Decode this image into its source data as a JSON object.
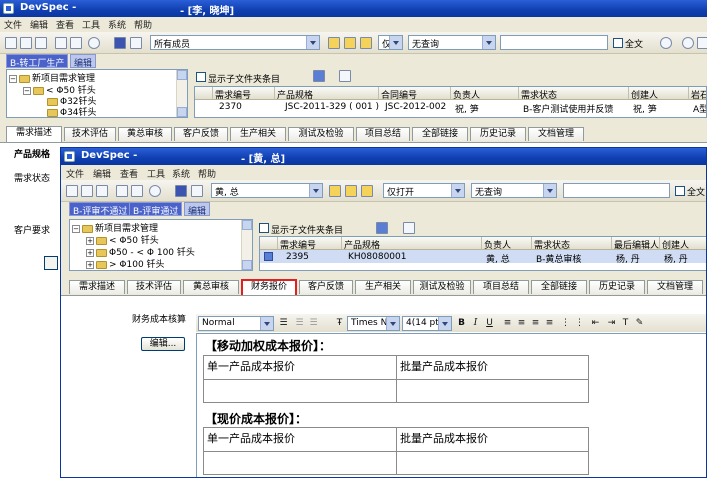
{
  "back_window": {
    "title": "DevSpec -",
    "user": "- [李, 晓坤]",
    "menu": [
      "文件",
      "编辑",
      "查看",
      "工具",
      "系统",
      "帮助"
    ],
    "member_filter": "所有成员",
    "open_filter": "仅打开",
    "query_filter": "无查询",
    "search_value": "",
    "fulltext_label": "全文",
    "buttons": {
      "transfer": "B-转工厂生产",
      "edit": "编辑"
    },
    "tree": [
      {
        "label": "新项目需求管理",
        "level": 0
      },
      {
        "label": "< Φ50 钎头",
        "level": 1
      },
      {
        "label": "Φ32钎头",
        "level": 2
      },
      {
        "label": "Φ34钎头",
        "level": 2
      }
    ],
    "show_subfolder": "显示子文件夹条目",
    "grid_headers": [
      "需求编号",
      "产品规格",
      "合同编号",
      "负责人",
      "需求状态",
      "创建人",
      "岩石"
    ],
    "grid_row": {
      "id": "2370",
      "spec": "JSC-2011-329 ( 001 )",
      "contract": "JSC-2012-002",
      "owner": "祝, 笋",
      "status": "B-客户测试使用并反馈",
      "creator": "祝, 笋",
      "rock": "A型"
    },
    "tabs": [
      "需求描述",
      "技术评估",
      "黄总审核",
      "客户反馈",
      "生产相关",
      "测试及检验",
      "项目总结",
      "全部链接",
      "历史记录",
      "文档管理"
    ],
    "side_labels": [
      "产品规格",
      "需求状态",
      "客户要求"
    ]
  },
  "front_window": {
    "title": "DevSpec -",
    "user": "- [黄, 总]",
    "menu": [
      "文件",
      "编辑",
      "查看",
      "工具",
      "系统",
      "帮助"
    ],
    "member_filter": "黄, 总",
    "open_filter": "仅打开",
    "query_filter": "无查询",
    "search_value": "",
    "fulltext_label": "全文",
    "buttons": {
      "reject": "B-评审不通过",
      "pass": "B-评审通过",
      "edit": "编辑"
    },
    "tree": [
      {
        "label": "新项目需求管理",
        "level": 0
      },
      {
        "label": "< Φ50 钎头",
        "level": 1
      },
      {
        "label": "Φ50 - < Φ 100 钎头",
        "level": 1
      },
      {
        "label": "> Φ100 钎头",
        "level": 1
      }
    ],
    "show_subfolder": "显示子文件夹条目",
    "grid_headers": [
      "需求编号",
      "产品规格",
      "负责人",
      "需求状态",
      "最后编辑人",
      "创建人"
    ],
    "grid_row": {
      "id": "2395",
      "spec": "KH08080001",
      "owner": "黄, 总",
      "status": "B-黄总审核",
      "editor": "杨, 丹",
      "creator": "杨, 丹"
    },
    "tabs": [
      "需求描述",
      "技术评估",
      "黄总审核",
      "财务报价",
      "客户反馈",
      "生产相关",
      "测试及检验",
      "项目总结",
      "全部链接",
      "历史记录",
      "文档管理"
    ],
    "active_tab": "财务报价",
    "field_label": "财务成本核算",
    "edit_button": "编辑...",
    "editor_toolbar": {
      "style": "Normal",
      "font": "Times Ne",
      "size": "4(14 pt)"
    },
    "sections": [
      {
        "heading": "【移动加权成本报价】：",
        "col1": "单一产品成本报价",
        "col2": "批量产品成本报价"
      },
      {
        "heading": "【现价成本报价】：",
        "col1": "单一产品成本报价",
        "col2": "批量产品成本报价"
      }
    ]
  },
  "colors": {
    "titlebar": "#0f3fb0",
    "button": "#4a62c9",
    "active_tab_border": "#e02020",
    "chrome": "#ece9d8"
  },
  "icons": [
    "app-icon",
    "folder-icon",
    "plus-icon",
    "filter-icon",
    "search-icon",
    "save-icon",
    "print-icon"
  ]
}
